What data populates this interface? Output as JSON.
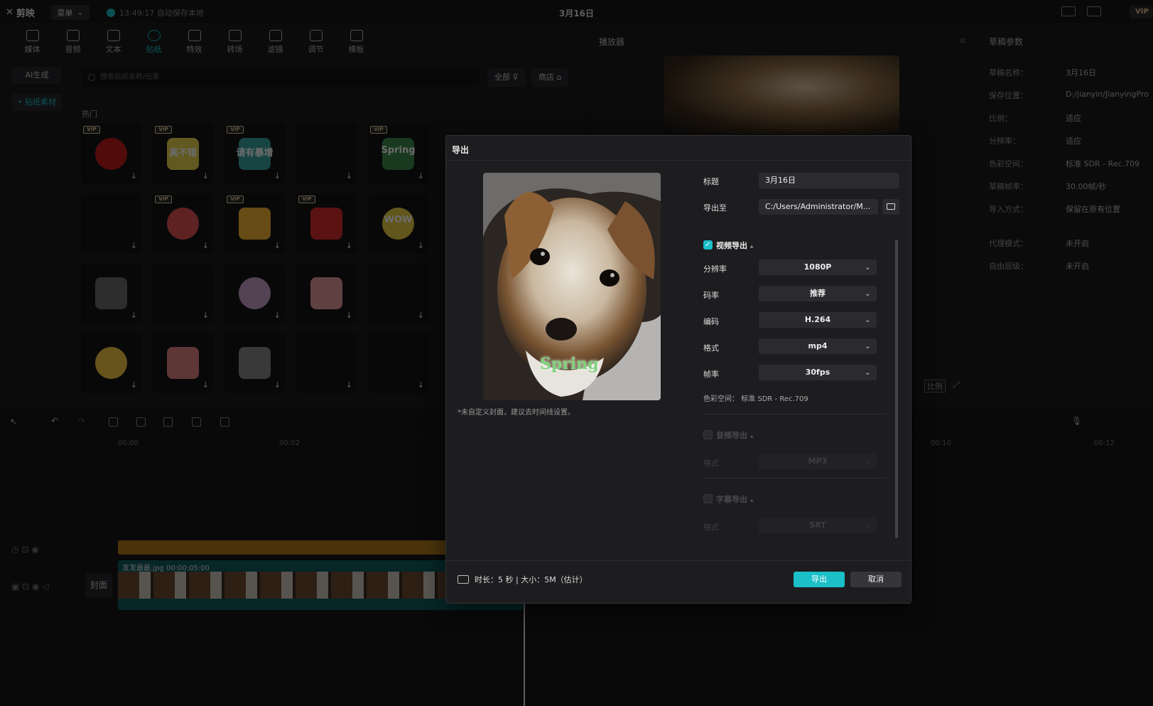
{
  "app": {
    "name": "剪映",
    "window_title": "3月16日",
    "menu_label": "菜单",
    "autosave": "13:49:17 自动保存本地",
    "vip": "VIP"
  },
  "toolbar": [
    {
      "id": "media",
      "label": "媒体"
    },
    {
      "id": "audio",
      "label": "音频"
    },
    {
      "id": "text",
      "label": "文本"
    },
    {
      "id": "sticker",
      "label": "贴纸"
    },
    {
      "id": "effects",
      "label": "特效"
    },
    {
      "id": "transition",
      "label": "转场"
    },
    {
      "id": "filter",
      "label": "滤镜"
    },
    {
      "id": "adjust",
      "label": "调节"
    },
    {
      "id": "template",
      "label": "模板"
    }
  ],
  "sidebar": {
    "ai": "AI生成",
    "stickers": "• 贴纸素材"
  },
  "search": {
    "placeholder": "搜索贴纸名称/元素"
  },
  "filters": {
    "all": "全部",
    "store": "商店"
  },
  "section_hot": "热门",
  "stickers": {
    "vip_label": "VIP",
    "download_glyph": "↓",
    "texts": {
      "s2": "真不错",
      "s3": "请有暴增",
      "s5": "Spring",
      "s10": "WOW"
    }
  },
  "player": {
    "title": "播放器",
    "ratio_label": "比例"
  },
  "draft": {
    "title": "草稿参数",
    "rows": [
      {
        "k": "草稿名称：",
        "v": "3月16日"
      },
      {
        "k": "保存位置：",
        "v": "D:/jianyin/JianyingPro"
      },
      {
        "k": "比例：",
        "v": "适应"
      },
      {
        "k": "分辨率：",
        "v": "适应"
      },
      {
        "k": "色彩空间：",
        "v": "标准 SDR - Rec.709"
      },
      {
        "k": "草稿帧率：",
        "v": "30.00帧/秒"
      },
      {
        "k": "导入方式：",
        "v": "保留在原有位置"
      },
      {
        "k": "代理模式：",
        "v": "未开启"
      },
      {
        "k": "自由层级：",
        "v": "未开启"
      }
    ]
  },
  "timeline": {
    "ticks": [
      "00:00",
      "00:02",
      "00:10",
      "00:12"
    ],
    "clip_name": "发发最最.jpg",
    "clip_duration": "00:00:05:00",
    "cover_label": "封面"
  },
  "dialog": {
    "title": "导出",
    "cover_note": "*未自定义封面，建议去时间线设置。",
    "cover_sticker": "Spring",
    "title_label": "标题",
    "title_value": "3月16日",
    "export_to_label": "导出至",
    "export_to_value": "C:/Users/Administrator/M...",
    "video_export": "视频导出",
    "resolution_label": "分辨率",
    "resolution": "1080P",
    "bitrate_label": "码率",
    "bitrate": "推荐",
    "codec_label": "编码",
    "codec": "H.264",
    "format_label": "格式",
    "format": "mp4",
    "fps_label": "帧率",
    "fps": "30fps",
    "color_space": "色彩空间： 标准 SDR - Rec.709",
    "audio_export": "音频导出",
    "audio_format_label": "格式",
    "audio_format": "MP3",
    "subtitle_export": "字幕导出",
    "subtitle_format_label": "格式",
    "subtitle_format": "SRT",
    "footer_info": "时长：5 秒 | 大小：5M（估计）",
    "export_btn": "导出",
    "cancel_btn": "取消",
    "accent": "#1bbfc8"
  }
}
